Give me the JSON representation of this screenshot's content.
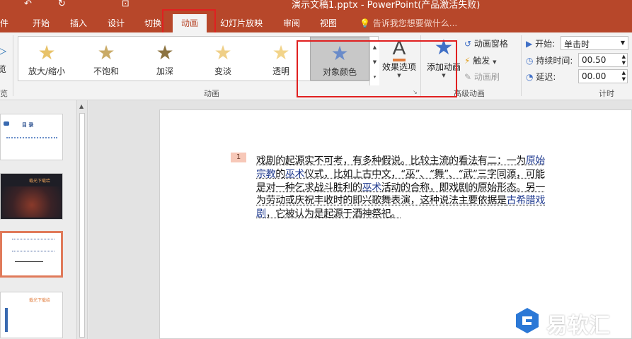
{
  "window": {
    "title": "演示文稿1.pptx - PowerPoint(产品激活失败)",
    "qa_undo": "↶",
    "qa_redo": "↻"
  },
  "tabs": {
    "file": "件",
    "home": "开始",
    "insert": "插入",
    "design": "设计",
    "transitions": "切换",
    "animations": "动画",
    "slideshow": "幻灯片放映",
    "review": "审阅",
    "view": "视图",
    "tellme": "告诉我您想要做什么..."
  },
  "ribbon": {
    "preview_label": "览",
    "preview_group": "览",
    "effects": [
      {
        "label": "放大/缩小",
        "icon": "grow-shrink-star-icon"
      },
      {
        "label": "不饱和",
        "icon": "desaturate-star-icon"
      },
      {
        "label": "加深",
        "icon": "darken-star-icon"
      },
      {
        "label": "变淡",
        "icon": "lighten-star-icon"
      },
      {
        "label": "透明",
        "icon": "transparency-star-icon"
      },
      {
        "label": "对象颜色",
        "icon": "object-color-star-icon"
      }
    ],
    "effect_options": "效果选项",
    "animation_group": "动画",
    "add_animation": "添加动画",
    "animation_pane": "动画窗格",
    "trigger": "触发",
    "animation_painter": "动画刷",
    "advanced_group": "高级动画",
    "start_label": "开始:",
    "start_value": "单击时",
    "duration_label": "持续时间:",
    "duration_value": "00.50",
    "delay_label": "延迟:",
    "delay_value": "00.00",
    "timing_group": "计时",
    "colors": {
      "accent": "#b7472a",
      "highlight": "#e02020"
    }
  },
  "thumbnails": {
    "slide1_heading": "目 录",
    "slide2_heading": "载光下载给",
    "slide4_heading": "载光下载给"
  },
  "slide": {
    "anim_order": "1",
    "paragraph": {
      "p1": "戏剧的起源实不可考，有多种假说。比较主流的看法有二：一为",
      "link1": "原始宗教",
      "p2": "的",
      "link2": "巫术",
      "p3": "仪式，比如上古中文，“巫”、“舞”、“武”三字同源，可能是对一种乞求战斗胜利的",
      "link3": "巫术",
      "p4": "活动的合称，即戏剧的原始形态。另一为劳动或庆祝丰收时的即兴歌舞表演，这种说法主要依据是",
      "link4": "古希腊戏剧",
      "p5": "，它被认为是起源于酒神祭祀。"
    }
  },
  "watermark": {
    "text": "易软汇"
  }
}
